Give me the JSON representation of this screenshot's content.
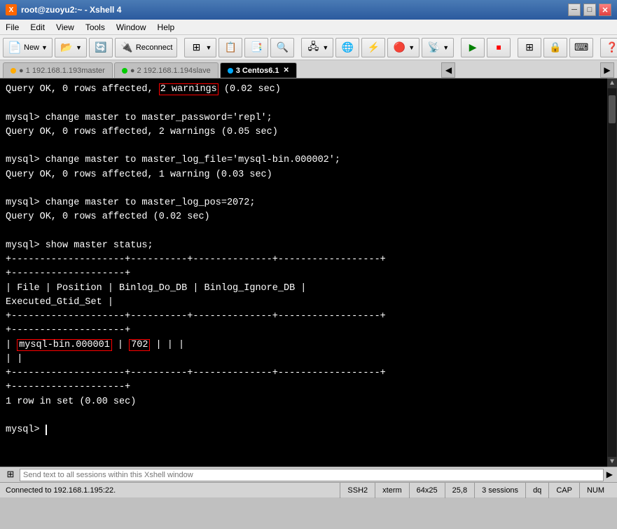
{
  "title": "root@zuoyu2:~ - Xshell 4",
  "title_icon": "🖥",
  "menu": {
    "items": [
      "File",
      "Edit",
      "View",
      "Tools",
      "Window",
      "Help"
    ]
  },
  "toolbar": {
    "new_label": "New",
    "reconnect_label": "Reconnect"
  },
  "tabs": [
    {
      "id": 1,
      "label": "192.168.1.193master",
      "dot_color": "#ffaa00",
      "active": false
    },
    {
      "id": 2,
      "label": "192.168.1.194slave",
      "dot_color": "#00cc00",
      "active": false
    },
    {
      "id": 3,
      "label": "3 Centos6.1",
      "dot_color": "#00aaff",
      "active": true,
      "closable": true
    }
  ],
  "terminal": {
    "lines": [
      "Query OK, 0 rows affected, 2 warnings (0.02 sec)",
      "",
      "mysql> change master to master_password='repl';",
      "Query OK, 0 rows affected, 2 warnings (0.05 sec)",
      "",
      "mysql> change master to master_log_file='mysql-bin.000002';",
      "Query OK, 0 rows affected, 1 warning (0.03 sec)",
      "",
      "mysql> change master to master_log_pos=2072;",
      "Query OK, 0 rows affected (0.02 sec)",
      "",
      "mysql> show master status;",
      "+--------------------+----------+--------------+------------------+",
      "+--------------------+",
      "| File               | Position | Binlog_Do_DB | Binlog_Ignore_DB |",
      "  Executed_Gtid_Set |",
      "+--------------------+----------+--------------+------------------+",
      "+--------------------+",
      "| mysql-bin.000001   |      702 |              |                  |",
      "|                    |",
      "+--------------------+----------+--------------+------------------+",
      "+--------------------+",
      "1 row in set (0.00 sec)",
      "",
      "mysql> _"
    ],
    "highlighted": {
      "line": 0,
      "text": "2 warnings"
    }
  },
  "send_bar": {
    "placeholder": "Send text to all sessions within this Xshell window"
  },
  "status_bar": {
    "connected": "Connected to 192.168.1.195:22.",
    "ssh_type": "SSH2",
    "term": "xterm",
    "size": "64x25",
    "cursor": "25,8",
    "sessions": "3 sessions",
    "caps": "CAP",
    "num": "NUM"
  }
}
